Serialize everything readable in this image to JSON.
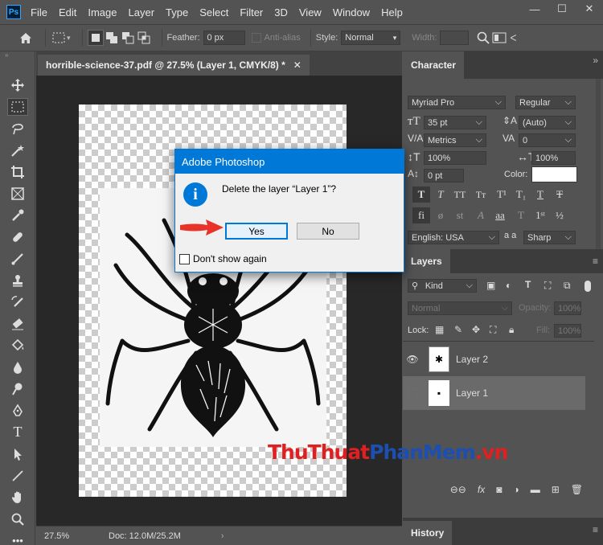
{
  "app": {
    "logo": "Ps"
  },
  "menu": [
    "File",
    "Edit",
    "Image",
    "Layer",
    "Type",
    "Select",
    "Filter",
    "3D",
    "View",
    "Window",
    "Help"
  ],
  "window_controls": {
    "minimize": "—",
    "maximize": "☐",
    "close": "✕"
  },
  "options": {
    "feather_label": "Feather:",
    "feather_value": "0 px",
    "antialias_label": "Anti-alias",
    "style_label": "Style:",
    "style_value": "Normal",
    "width_label": "Width:"
  },
  "document": {
    "tab_title": "horrible-science-37.pdf @ 27.5% (Layer 1, CMYK/8) *",
    "zoom": "27.5%",
    "doc_info": "Doc: 12.0M/25.2M"
  },
  "character": {
    "tab": "Character",
    "font_family": "Myriad Pro",
    "font_style": "Regular",
    "size": "35 pt",
    "leading": "(Auto)",
    "kerning": "Metrics",
    "tracking": "0",
    "vscale": "100%",
    "hscale": "100%",
    "baseline": "0 pt",
    "color_label": "Color:",
    "language": "English: USA",
    "aa_label": "a a",
    "antialias": "Sharp"
  },
  "layers": {
    "tab": "Layers",
    "filter": "Kind",
    "blend_mode": "Normal",
    "opacity_label": "Opacity:",
    "opacity": "100%",
    "lock_label": "Lock:",
    "fill_label": "Fill:",
    "fill": "100%",
    "items": [
      {
        "name": "Layer 2",
        "visible": true,
        "selected": false
      },
      {
        "name": "Layer 1",
        "visible": false,
        "selected": true
      }
    ]
  },
  "history": {
    "tab": "History"
  },
  "dialog": {
    "title": "Adobe Photoshop",
    "message": "Delete the layer “Layer 1”?",
    "yes": "Yes",
    "no": "No",
    "checkbox": "Don't show again"
  },
  "watermark": {
    "part1": "ThuThuat",
    "part2": "PhanMem",
    "part3": ".vn"
  },
  "colors": {
    "accent": "#0078d7",
    "panel": "#535353",
    "canvas_bg": "#282828",
    "arrow": "#e8332a"
  }
}
